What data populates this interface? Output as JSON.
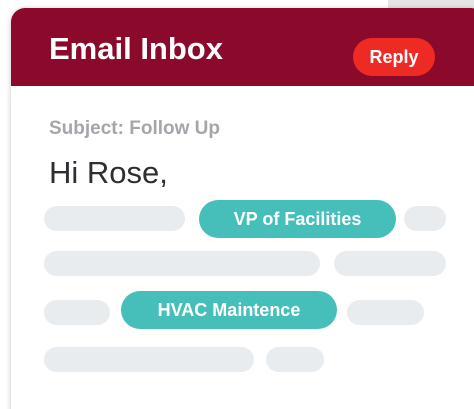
{
  "email": {
    "title": "Email Inbox",
    "reply_label": "Reply",
    "subject": "Subject: Follow Up",
    "greeting": "Hi Rose,",
    "tags": [
      "VP of Facilities",
      "HVAC Maintence"
    ]
  },
  "colors": {
    "header": "#8b0a2c",
    "reply_button": "#ee2a24",
    "tag": "#46bfba",
    "placeholder": "#e9ecef",
    "subject_text": "#a3a6aa"
  }
}
